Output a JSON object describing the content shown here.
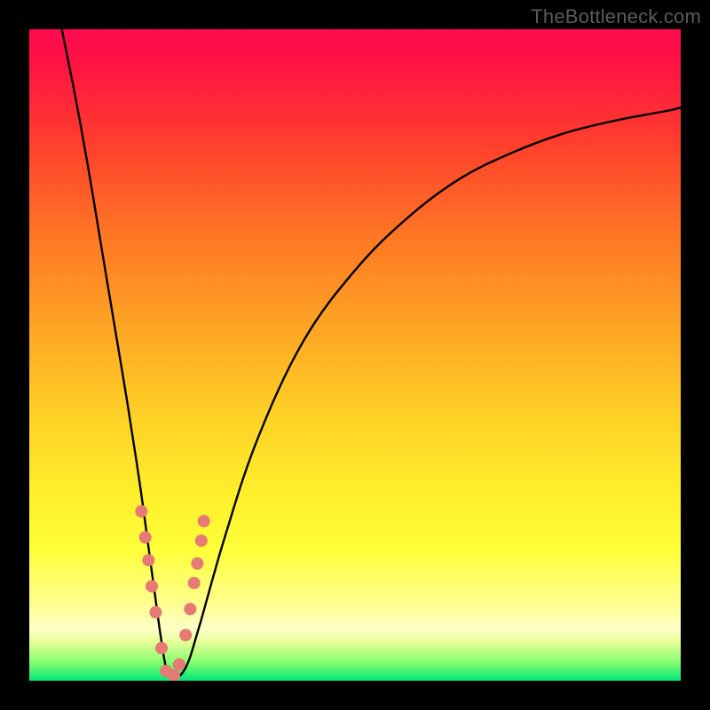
{
  "watermark": "TheBottleneck.com",
  "colors": {
    "frame": "#000000",
    "curve": "#000000",
    "marker_fill": "#e77a74",
    "marker_stroke": "#c44d49"
  },
  "chart_data": {
    "type": "line",
    "title": "",
    "xlabel": "",
    "ylabel": "",
    "xlim": [
      0,
      100
    ],
    "ylim": [
      0,
      100
    ],
    "notes": "Bottleneck-style V-curve chart. X axis is a normalized hardware/pairing scale; Y axis is bottleneck percentage (0 at bottom = no bottleneck, 100 at top = full bottleneck). No axis ticks or numeric labels are rendered; values are estimated from the curve shape. Pink markers highlight a cluster of sampled points near the minimum.",
    "series": [
      {
        "name": "bottleneck-curve",
        "x": [
          5,
          7,
          9,
          11,
          13,
          15,
          17,
          18.5,
          20,
          21,
          22,
          24,
          26,
          30,
          35,
          42,
          50,
          58,
          66,
          74,
          82,
          90,
          98,
          100
        ],
        "y": [
          100,
          90,
          79,
          67,
          55,
          43,
          30,
          19,
          8,
          2,
          0.3,
          2,
          8,
          22,
          37,
          52,
          63,
          71,
          77,
          81,
          84,
          86,
          87.5,
          88
        ]
      }
    ],
    "markers": {
      "name": "highlighted-points",
      "shape": "circle",
      "approx_radius_px": 7,
      "x": [
        17.2,
        17.8,
        18.3,
        18.8,
        19.4,
        20.3,
        21.0,
        22.2,
        23.0,
        24.0,
        24.7,
        25.3,
        25.8,
        26.4,
        26.8
      ],
      "y": [
        26.0,
        22.0,
        18.5,
        14.5,
        10.5,
        5.0,
        1.5,
        0.8,
        2.5,
        7.0,
        11.0,
        15.0,
        18.0,
        21.5,
        24.5
      ]
    }
  }
}
